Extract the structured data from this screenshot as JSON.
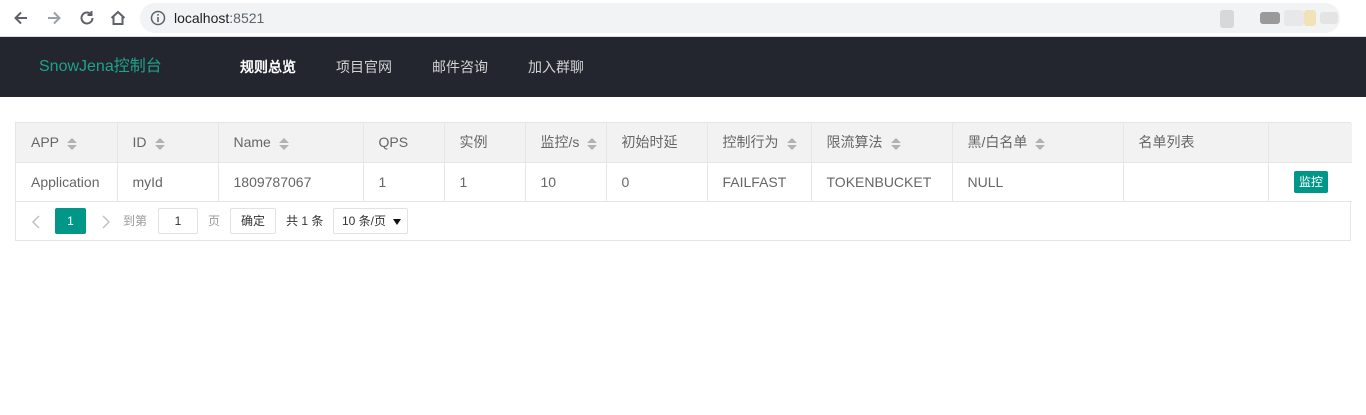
{
  "browser": {
    "url_host": "localhost",
    "url_port": ":8521"
  },
  "header": {
    "brand": "SnowJena控制台",
    "nav": [
      {
        "label": "规则总览",
        "active": true
      },
      {
        "label": "项目官网",
        "active": false
      },
      {
        "label": "邮件咨询",
        "active": false
      },
      {
        "label": "加入群聊",
        "active": false
      }
    ]
  },
  "table": {
    "columns": [
      {
        "label": "APP",
        "sortable": true
      },
      {
        "label": "ID",
        "sortable": true
      },
      {
        "label": "Name",
        "sortable": true
      },
      {
        "label": "QPS",
        "sortable": false
      },
      {
        "label": "实例",
        "sortable": false
      },
      {
        "label": "监控/s",
        "sortable": true
      },
      {
        "label": "初始时延",
        "sortable": false
      },
      {
        "label": "控制行为",
        "sortable": true
      },
      {
        "label": "限流算法",
        "sortable": true
      },
      {
        "label": "黑/白名单",
        "sortable": true
      },
      {
        "label": "名单列表",
        "sortable": false
      },
      {
        "label": "",
        "sortable": false
      }
    ],
    "rows": [
      {
        "cells": [
          "Application",
          "myId",
          "1809787067",
          "1",
          "1",
          "10",
          "0",
          "FAILFAST",
          "TOKENBUCKET",
          "NULL",
          ""
        ],
        "action_label": "监控"
      }
    ]
  },
  "pagination": {
    "current_page": "1",
    "goto_label": "到第",
    "goto_value": "1",
    "page_unit": "页",
    "confirm_label": "确定",
    "total_label": "共 1 条",
    "page_size": "10 条/页"
  },
  "colors": {
    "header_bg": "#23262e",
    "brand": "#1ea28a",
    "accent": "#009688"
  }
}
